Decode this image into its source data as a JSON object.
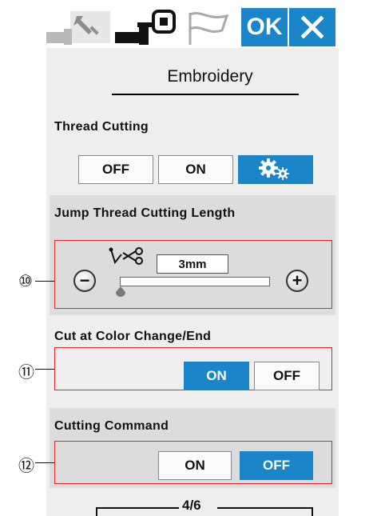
{
  "header": {
    "tabs": [
      {
        "name": "tools",
        "icon": "wrench-icon"
      },
      {
        "name": "embroidery",
        "icon": "embroidery-hoop-icon"
      },
      {
        "name": "flag",
        "icon": "flag-icon"
      }
    ],
    "ok_label": "OK",
    "close_icon": "close-icon"
  },
  "page_title": "Embroidery",
  "thread_cutting": {
    "label": "Thread Cutting",
    "off_label": "OFF",
    "on_label": "ON",
    "settings_icon": "gears-icon",
    "selected": "settings"
  },
  "jump_thread": {
    "label": "Jump Thread Cutting Length",
    "value": "3mm",
    "minus_label": "−",
    "plus_label": "+",
    "slider_fraction": 0.0,
    "icon": "jump-thread-scissors-icon"
  },
  "cut_color_change": {
    "label": "Cut at Color Change/End",
    "on_label": "ON",
    "off_label": "OFF",
    "selected": "ON"
  },
  "cutting_command": {
    "label": "Cutting Command",
    "on_label": "ON",
    "off_label": "OFF",
    "selected": "OFF"
  },
  "callouts": [
    "⑩",
    "⑪",
    "⑫"
  ],
  "pager": "4/6",
  "colors": {
    "accent": "#1a86c9",
    "highlight_box": "#e0282e",
    "panel_bg": "#dcdcdc",
    "screen_bg": "#eeeeee"
  }
}
